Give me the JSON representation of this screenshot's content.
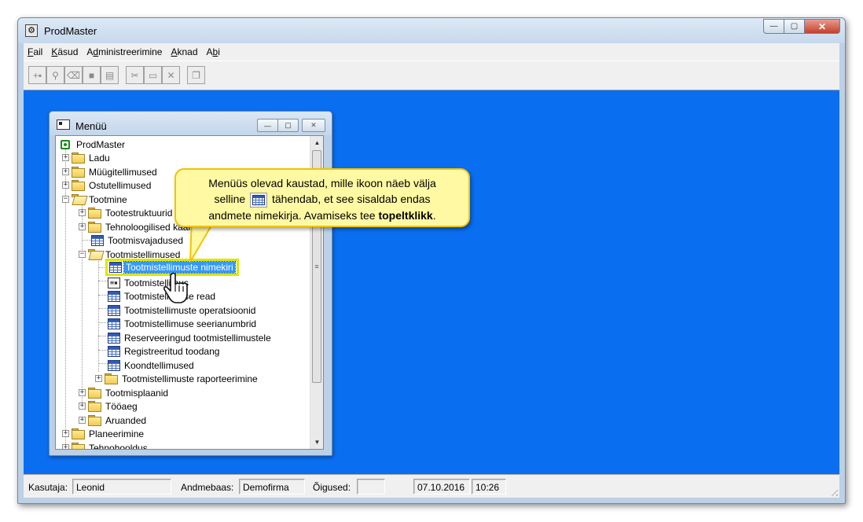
{
  "window": {
    "title": "ProdMaster",
    "buttons": {
      "minimize": "—",
      "maximize": "▢",
      "close": "✕"
    }
  },
  "menubar": {
    "items": [
      {
        "pre": "",
        "key": "F",
        "post": "ail"
      },
      {
        "pre": "",
        "key": "K",
        "post": "äsud"
      },
      {
        "pre": "A",
        "key": "d",
        "post": "ministreerimine"
      },
      {
        "pre": "",
        "key": "A",
        "post": "knad"
      },
      {
        "pre": "A",
        "key": "b",
        "post": "i"
      }
    ]
  },
  "toolbar": {
    "buttons": [
      {
        "name": "new-record-icon",
        "glyph": "+▪"
      },
      {
        "name": "binoculars-icon",
        "glyph": "⚲"
      },
      {
        "name": "eraser-icon",
        "glyph": "⌫"
      },
      {
        "name": "stop-icon",
        "glyph": "■"
      },
      {
        "name": "document-icon",
        "glyph": "▤"
      },
      {
        "name": "cut-icon",
        "glyph": "✂"
      },
      {
        "name": "folder-icon",
        "glyph": "▭"
      },
      {
        "name": "delete-icon",
        "glyph": "✕"
      },
      {
        "name": "copy-icon",
        "glyph": "❐"
      }
    ]
  },
  "menu_window": {
    "title": "Menüü",
    "root": "ProdMaster",
    "items": {
      "ladu": "Ladu",
      "myygitellimused": "Müügitellimused",
      "ostutellimused": "Ostutellimused",
      "tootmine": "Tootmine",
      "tootestruktuurid": "Tootestruktuurid",
      "tehnoloogilised": "Tehnoloogilised kaardid",
      "tootmisvajadused": "Tootmisvajadused",
      "tootmistellimused": "Tootmistellimused",
      "tt_nimekiri": "Tootmistellimuste nimekiri",
      "tt_vorm": "Tootmistellimus",
      "tt_read": "Tootmistellimuse read",
      "tt_operatsioonid": "Tootmistellimuste operatsioonid",
      "tt_seerianumbrid": "Tootmistellimuse seerianumbrid",
      "reserveeringud": "Reserveeringud tootmistellimustele",
      "registreeritud": "Registreeritud toodang",
      "koondtellimused": "Koondtellimused",
      "raporteerimine": "Tootmistellimuste raporteerimine",
      "tootmisplaanid": "Tootmisplaanid",
      "tooaeg": "Tööaeg",
      "aruanded": "Aruanded",
      "planeerimine": "Planeerimine",
      "tehnohooldus": "Tehnohooldus"
    },
    "window_buttons": {
      "minimize": "—",
      "maximize": "▢",
      "close": "✕"
    }
  },
  "callout": {
    "line1": "Menüüs olevad kaustad, mille ikoon näeb välja",
    "line2_pre": "selline",
    "line2_post": "tähendab, et see sisaldab endas",
    "line3_pre": "andmete nimekirja. Avamiseks tee",
    "line3_bold": "topeltklikk",
    "line3_post": "."
  },
  "statusbar": {
    "user_label": "Kasutaja:",
    "user_value": "Leonid",
    "db_label": "Andmebaas:",
    "db_value": "Demofirma",
    "rights_label": "Õigused:",
    "rights_value": "",
    "date": "07.10.2016",
    "time": "10:26"
  },
  "colors": {
    "desktop": "#0a6ef0",
    "callout_fill": "#fff9a3",
    "callout_border": "#f2c300",
    "selection": "#3399ff",
    "highlight": "#dde600"
  }
}
